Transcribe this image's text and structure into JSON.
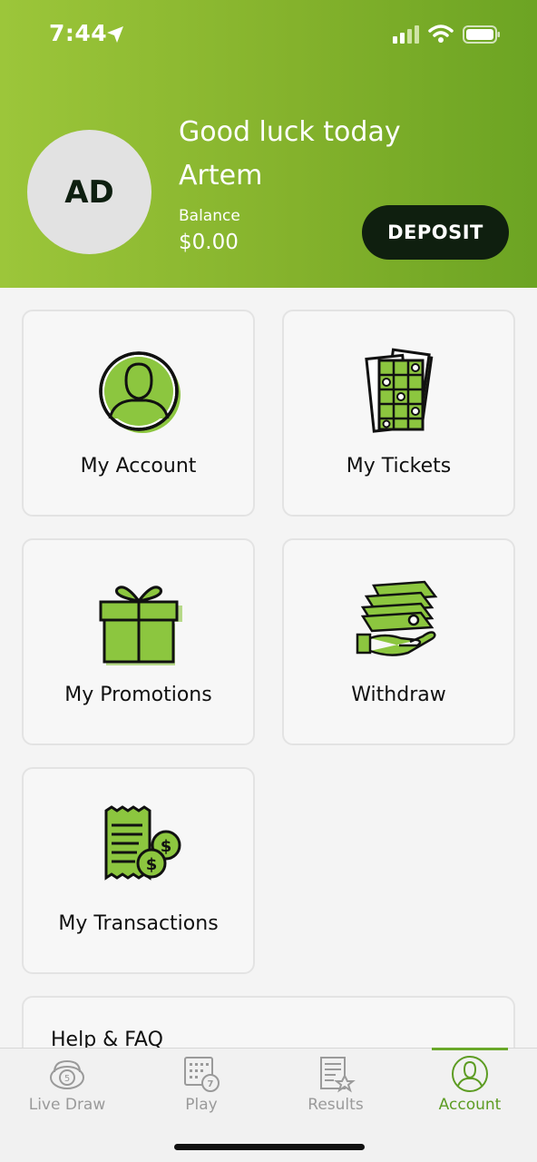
{
  "status_bar": {
    "time": "7:44"
  },
  "header": {
    "avatar_initials": "AD",
    "greeting": "Good luck today",
    "username": "Artem",
    "balance_label": "Balance",
    "balance_value": "$0.00",
    "deposit_label": "DEPOSIT"
  },
  "tiles": [
    {
      "label": "My Account",
      "icon": "user-icon"
    },
    {
      "label": "My Tickets",
      "icon": "tickets-icon"
    },
    {
      "label": "My Promotions",
      "icon": "gift-icon"
    },
    {
      "label": "Withdraw",
      "icon": "cash-hand-icon"
    },
    {
      "label": "My Transactions",
      "icon": "receipt-coins-icon"
    }
  ],
  "help": {
    "label": "Help & FAQ"
  },
  "tabs": [
    {
      "label": "Live Draw",
      "icon": "live-draw-icon",
      "badge": "5"
    },
    {
      "label": "Play",
      "icon": "play-icon",
      "badge": "7"
    },
    {
      "label": "Results",
      "icon": "results-icon"
    },
    {
      "label": "Account",
      "icon": "account-icon",
      "active": true
    }
  ],
  "colors": {
    "brand_green": "#84b22c",
    "accent_green": "#8cc63f",
    "dark": "#0f1f0f",
    "tab_active": "#5d9c23",
    "tab_inactive": "#9a9a9a"
  }
}
